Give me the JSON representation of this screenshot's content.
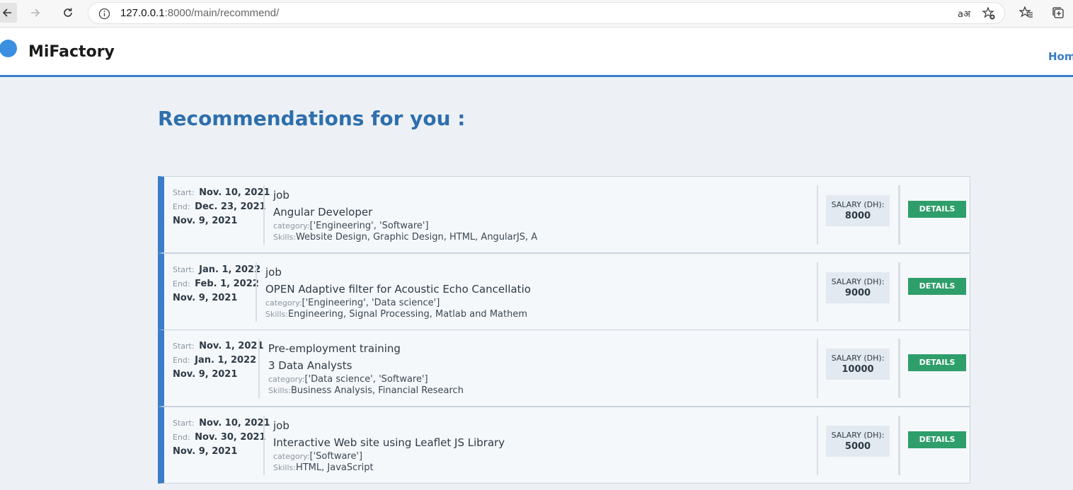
{
  "browser": {
    "url_host": "127.0.0.1",
    "url_path": ":8000/main/recommend/",
    "read_aloud": "aअ",
    "icons": [
      "back-icon",
      "forward-icon",
      "reload-icon",
      "info-icon",
      "read-aloud-icon",
      "add-favorite-icon",
      "favorites-icon",
      "collections-icon"
    ]
  },
  "header": {
    "brand": "MiFactory",
    "nav_home": "Hom"
  },
  "main": {
    "title": "Recommendations for you :",
    "labels": {
      "start": "Start:",
      "end": "End:",
      "category": "category:",
      "skills": "Skills:",
      "salary": "SALARY (DH):",
      "details": "DETAILS"
    },
    "jobs": [
      {
        "start": "Nov. 10, 2021",
        "end": "Dec. 23, 2021",
        "posted": "Nov. 9, 2021",
        "type": "job",
        "title": "Angular Developer",
        "category": "['Engineering', 'Software']",
        "skills": "Website Design, Graphic Design, HTML, AngularJS, A",
        "salary": "8000"
      },
      {
        "start": "Jan. 1, 2022",
        "end": "Feb. 1, 2022",
        "posted": "Nov. 9, 2021",
        "type": "job",
        "title": "OPEN Adaptive filter for Acoustic Echo Cancellatio",
        "category": "['Engineering', 'Data science']",
        "skills": "Engineering, Signal Processing, Matlab and Mathem",
        "salary": "9000"
      },
      {
        "start": "Nov. 1, 2021",
        "end": "Jan. 1, 2022",
        "posted": "Nov. 9, 2021",
        "type": "Pre-employment training",
        "title": "3 Data Analysts",
        "category": "['Data science', 'Software']",
        "skills": "Business Analysis, Financial Research",
        "salary": "10000"
      },
      {
        "start": "Nov. 10, 2021",
        "end": "Nov. 30, 2021",
        "posted": "Nov. 9, 2021",
        "type": "job",
        "title": "Interactive Web site using Leaflet JS Library",
        "category": "['Software']",
        "skills": "HTML, JavaScript",
        "salary": "5000"
      }
    ]
  },
  "colors": {
    "accent": "#3a7dc9",
    "title": "#2e6fad",
    "button": "#2e9e6a",
    "page_bg": "#edf1f5"
  }
}
